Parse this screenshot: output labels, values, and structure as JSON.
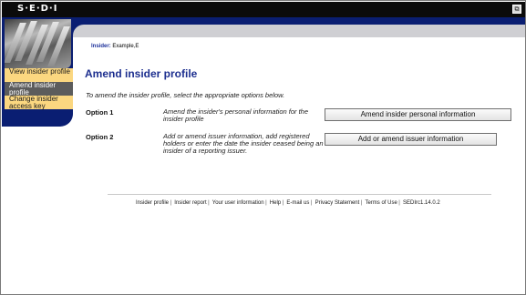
{
  "app": {
    "logo_text": "S·E·D·I",
    "window_button": "⧉"
  },
  "sidebar": {
    "items": [
      {
        "label": "View insider profile",
        "state": "normal"
      },
      {
        "label": "Amend insider profile",
        "state": "selected"
      },
      {
        "label": "Change insider access key",
        "state": "normal"
      }
    ]
  },
  "insider": {
    "label": "Insider:",
    "value": "Example,E"
  },
  "page": {
    "title": "Amend insider profile",
    "intro": "To amend the insider profile, select the appropriate options below."
  },
  "options": [
    {
      "label": "Option 1",
      "description": "Amend the insider's personal information for the insider profile",
      "button": "Amend insider personal information"
    },
    {
      "label": "Option 2",
      "description": "Add or amend issuer information, add registered holders or enter the date the insider ceased being an insider of a reporting issuer.",
      "button": "Add or amend issuer information"
    }
  ],
  "footer": {
    "links": [
      "Insider profile",
      "Insider report",
      "Your user information",
      "Help",
      "E-mail us",
      "Privacy Statement",
      "Terms of Use"
    ],
    "version": "SEDIrc1.14.0.2"
  },
  "colors": {
    "navy": "#0a1e72",
    "nav_link": "#fbd780",
    "nav_selected": "#5c5c5c",
    "title": "#1d2f8f"
  }
}
